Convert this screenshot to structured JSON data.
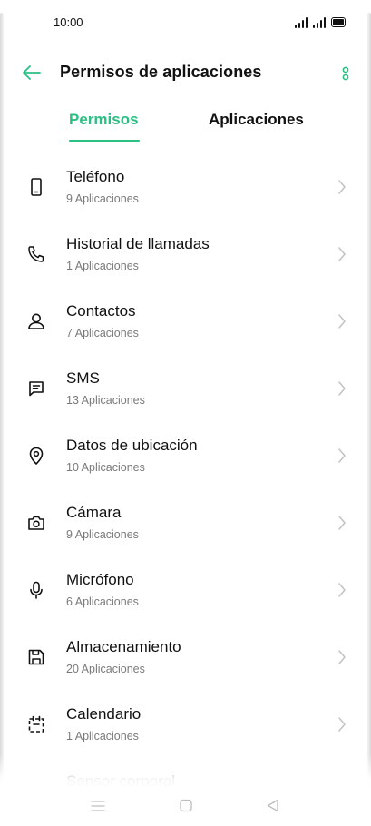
{
  "status_bar": {
    "time": "10:00"
  },
  "header": {
    "title": "Permisos de aplicaciones",
    "back_icon": "arrow-left-icon",
    "more_icon": "more-vertical-icon"
  },
  "tabs": [
    {
      "label": "Permisos",
      "active": true
    },
    {
      "label": "Aplicaciones",
      "active": false
    }
  ],
  "colors": {
    "accent": "#2bbf84",
    "text_primary": "#111111",
    "text_secondary": "#7a7a7a",
    "chevron": "#c2c2c2"
  },
  "permissions": [
    {
      "title": "Teléfono",
      "subtitle": "9 Aplicaciones",
      "icon": "phone-icon"
    },
    {
      "title": "Historial de llamadas",
      "subtitle": "1 Aplicaciones",
      "icon": "call-log-icon"
    },
    {
      "title": "Contactos",
      "subtitle": "7 Aplicaciones",
      "icon": "contacts-icon"
    },
    {
      "title": "SMS",
      "subtitle": "13 Aplicaciones",
      "icon": "sms-icon"
    },
    {
      "title": "Datos de ubicación",
      "subtitle": "10 Aplicaciones",
      "icon": "location-icon"
    },
    {
      "title": "Cámara",
      "subtitle": "9 Aplicaciones",
      "icon": "camera-icon"
    },
    {
      "title": "Micrófono",
      "subtitle": "6 Aplicaciones",
      "icon": "microphone-icon"
    },
    {
      "title": "Almacenamiento",
      "subtitle": "20 Aplicaciones",
      "icon": "storage-icon"
    },
    {
      "title": "Calendario",
      "subtitle": "1 Aplicaciones",
      "icon": "calendar-icon"
    },
    {
      "title": "Sensor corporal",
      "subtitle": "",
      "icon": "body-sensor-icon"
    }
  ],
  "nav_bar": {
    "icons": [
      "menu-icon",
      "home-icon",
      "back-triangle-icon"
    ]
  }
}
